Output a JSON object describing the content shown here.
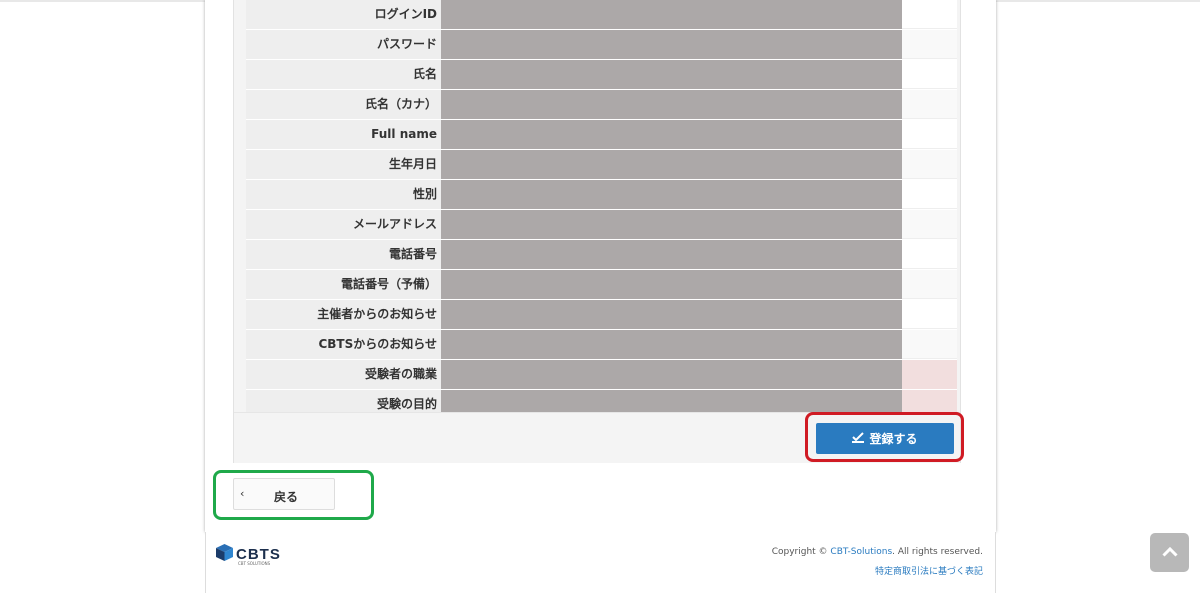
{
  "form": {
    "rows": [
      {
        "label": "ログインID"
      },
      {
        "label": "パスワード"
      },
      {
        "label": "氏名"
      },
      {
        "label": "氏名（カナ）"
      },
      {
        "label": "Full name"
      },
      {
        "label": "生年月日"
      },
      {
        "label": "性別"
      },
      {
        "label": "メールアドレス"
      },
      {
        "label": "電話番号"
      },
      {
        "label": "電話番号（予備）"
      },
      {
        "label": "主催者からのお知らせ"
      },
      {
        "label": "CBTSからのお知らせ"
      },
      {
        "label": "受験者の職業"
      },
      {
        "label": "受験の目的"
      }
    ]
  },
  "actions": {
    "register_label": "登録する",
    "back_label": "戻る"
  },
  "footer": {
    "logo_text": "CBTS",
    "logo_sub": "CBT SOLUTIONS",
    "copyright_prefix": "Copyright © ",
    "copyright_link": "CBT-Solutions",
    "copyright_suffix": ". All rights reserved.",
    "law_link": "特定商取引法に基づく表記"
  },
  "colors": {
    "primary": "#2a7bc0",
    "highlight_register": "#d01b24",
    "highlight_back": "#1fa94a",
    "masked": "#aca8a8",
    "required": "#f2dede"
  },
  "icons": {
    "register": "check-edit-icon",
    "back": "chevron-left-icon",
    "scroll_top": "chevron-up-icon"
  }
}
